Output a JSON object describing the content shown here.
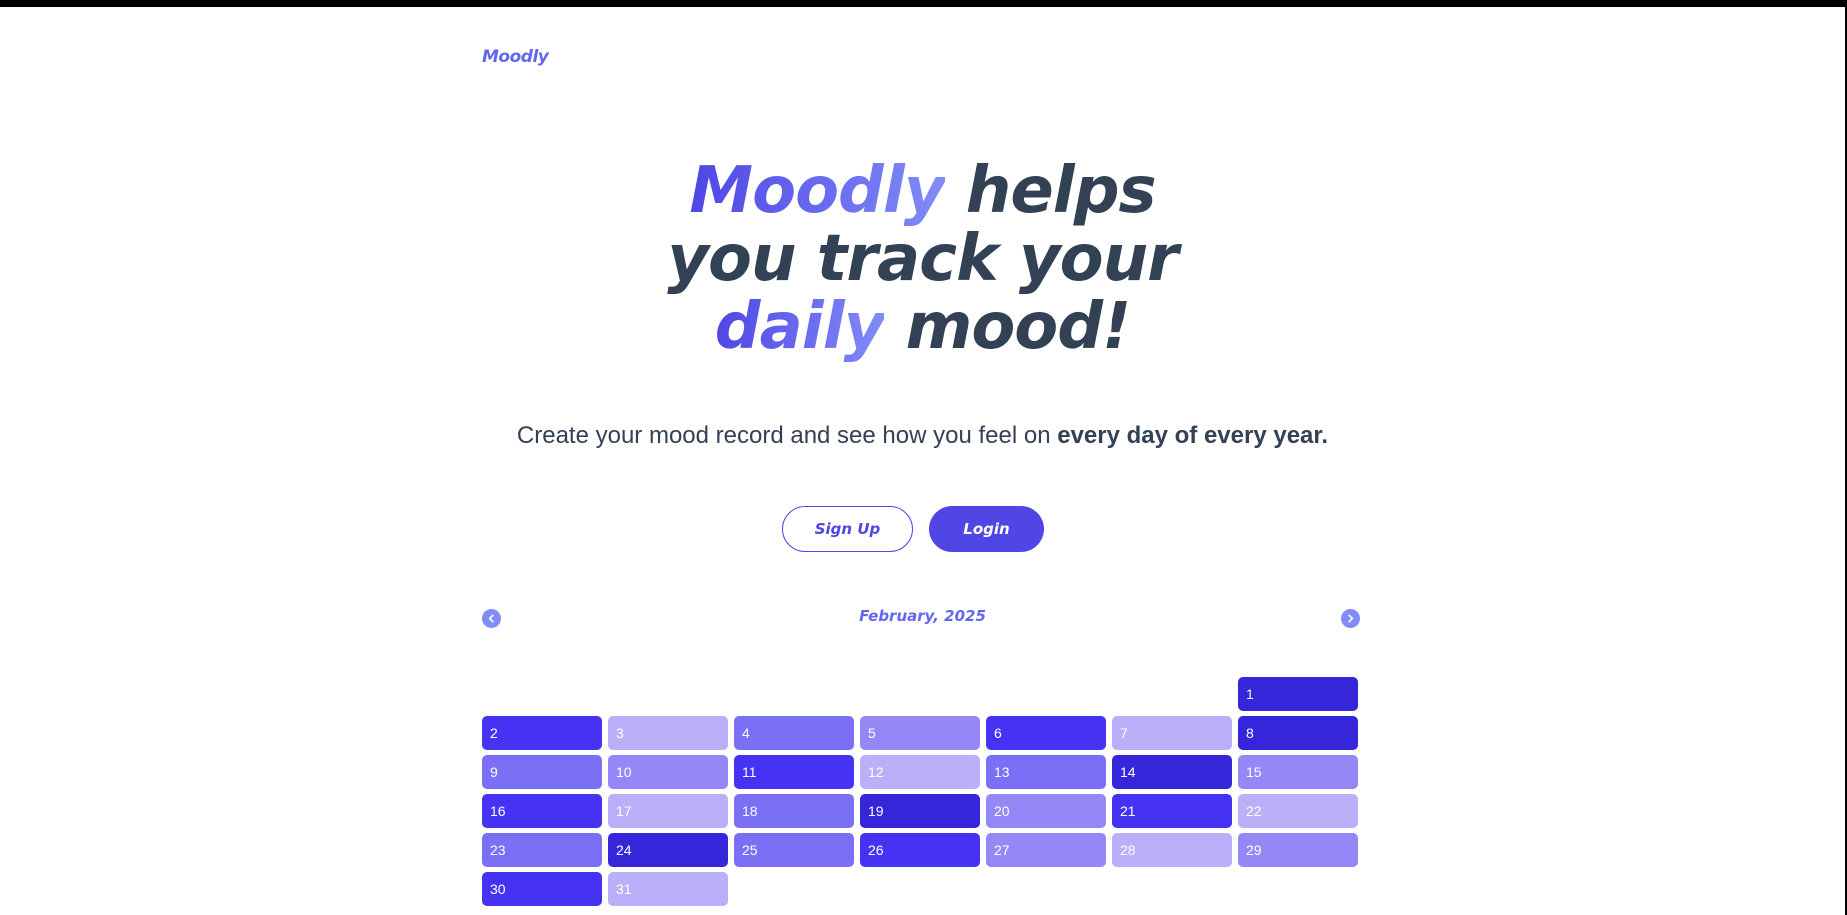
{
  "app": {
    "logo": "Moodly"
  },
  "hero": {
    "line1_accent": "Moodly",
    "line1_rest": " helps",
    "line2": "you track your",
    "line3_accent": "daily",
    "line3_rest": " mood!"
  },
  "subtitle": {
    "plain": "Create your mood record and see how you feel on ",
    "bold": "every day of every year."
  },
  "buttons": {
    "signup": "Sign Up",
    "login": "Login"
  },
  "calendar": {
    "month_label": "February, 2025",
    "prev_icon": "chevron-left-icon",
    "next_icon": "chevron-right-icon",
    "leading_blanks": 6,
    "mood_colors": {
      "darkest": "#3626d9",
      "dark": "#4632f2",
      "medium": "#7a6ff5",
      "light": "#9488f7",
      "lightest": "#b9b0f9"
    },
    "days": [
      {
        "day": "1",
        "mood": "darkest"
      },
      {
        "day": "2",
        "mood": "dark"
      },
      {
        "day": "3",
        "mood": "lightest"
      },
      {
        "day": "4",
        "mood": "medium"
      },
      {
        "day": "5",
        "mood": "light"
      },
      {
        "day": "6",
        "mood": "dark"
      },
      {
        "day": "7",
        "mood": "lightest"
      },
      {
        "day": "8",
        "mood": "darkest"
      },
      {
        "day": "9",
        "mood": "medium"
      },
      {
        "day": "10",
        "mood": "light"
      },
      {
        "day": "11",
        "mood": "dark"
      },
      {
        "day": "12",
        "mood": "lightest"
      },
      {
        "day": "13",
        "mood": "medium"
      },
      {
        "day": "14",
        "mood": "darkest"
      },
      {
        "day": "15",
        "mood": "light"
      },
      {
        "day": "16",
        "mood": "dark"
      },
      {
        "day": "17",
        "mood": "lightest"
      },
      {
        "day": "18",
        "mood": "medium"
      },
      {
        "day": "19",
        "mood": "darkest"
      },
      {
        "day": "20",
        "mood": "light"
      },
      {
        "day": "21",
        "mood": "dark"
      },
      {
        "day": "22",
        "mood": "lightest"
      },
      {
        "day": "23",
        "mood": "medium"
      },
      {
        "day": "24",
        "mood": "darkest"
      },
      {
        "day": "25",
        "mood": "medium"
      },
      {
        "day": "26",
        "mood": "dark"
      },
      {
        "day": "27",
        "mood": "light"
      },
      {
        "day": "28",
        "mood": "lightest"
      },
      {
        "day": "29",
        "mood": "light"
      },
      {
        "day": "30",
        "mood": "dark"
      },
      {
        "day": "31",
        "mood": "lightest"
      }
    ]
  }
}
